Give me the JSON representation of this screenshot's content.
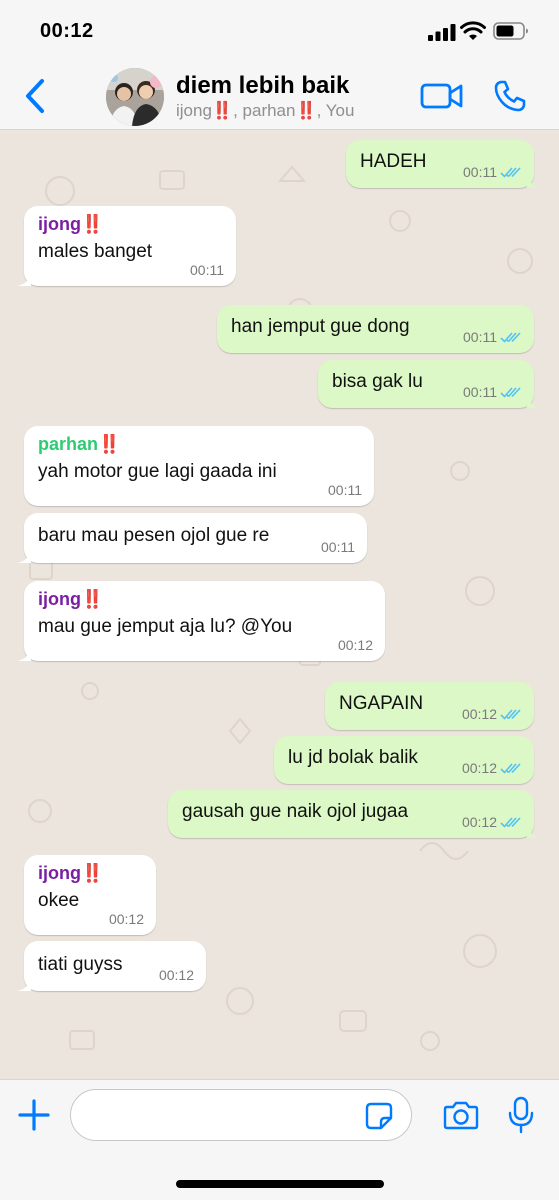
{
  "status_bar": {
    "time": "00:12"
  },
  "header": {
    "title": "diem lebih baik",
    "subtitle": "ijong‼️, parhan‼️, You"
  },
  "colors": {
    "accent": "#007AFF",
    "outgoing_bubble": "#DCF8C6",
    "incoming_bubble": "#FFFFFF",
    "ijong_name": "#7B1FA2",
    "parhan_name": "#2ECC71",
    "read_ticks": "#4FC3F7"
  },
  "messages": [
    {
      "direction": "out",
      "text": "HADEH",
      "time": "00:11",
      "status": "read"
    },
    {
      "direction": "in",
      "sender": "ijong‼️",
      "text": "males banget",
      "time": "00:11"
    },
    {
      "direction": "out",
      "text": "han jemput gue dong",
      "time": "00:11",
      "status": "read"
    },
    {
      "direction": "out",
      "text": "bisa gak lu",
      "time": "00:11",
      "status": "read"
    },
    {
      "direction": "in",
      "sender": "parhan‼️",
      "text": "yah motor gue lagi gaada ini",
      "time": "00:11"
    },
    {
      "direction": "in",
      "text": "baru mau pesen ojol gue re",
      "time": "00:11"
    },
    {
      "direction": "in",
      "sender": "ijong‼️",
      "text": "mau gue jemput aja lu? @You",
      "time": "00:12"
    },
    {
      "direction": "out",
      "text": "NGAPAIN",
      "time": "00:12",
      "status": "read"
    },
    {
      "direction": "out",
      "text": "lu jd bolak balik",
      "time": "00:12",
      "status": "read"
    },
    {
      "direction": "out",
      "text": "gausah gue naik ojol jugaa",
      "time": "00:12",
      "status": "read"
    },
    {
      "direction": "in",
      "sender": "ijong‼️",
      "text": "okee",
      "time": "00:12"
    },
    {
      "direction": "in",
      "text": "tiati guyss",
      "time": "00:12"
    }
  ],
  "input": {
    "value": "",
    "placeholder": ""
  },
  "icons": {
    "back": "chevron-left-icon",
    "video": "video-camera-icon",
    "call": "phone-icon",
    "attach": "plus-icon",
    "sticker": "sticker-icon",
    "camera": "camera-icon",
    "mic": "microphone-icon"
  }
}
